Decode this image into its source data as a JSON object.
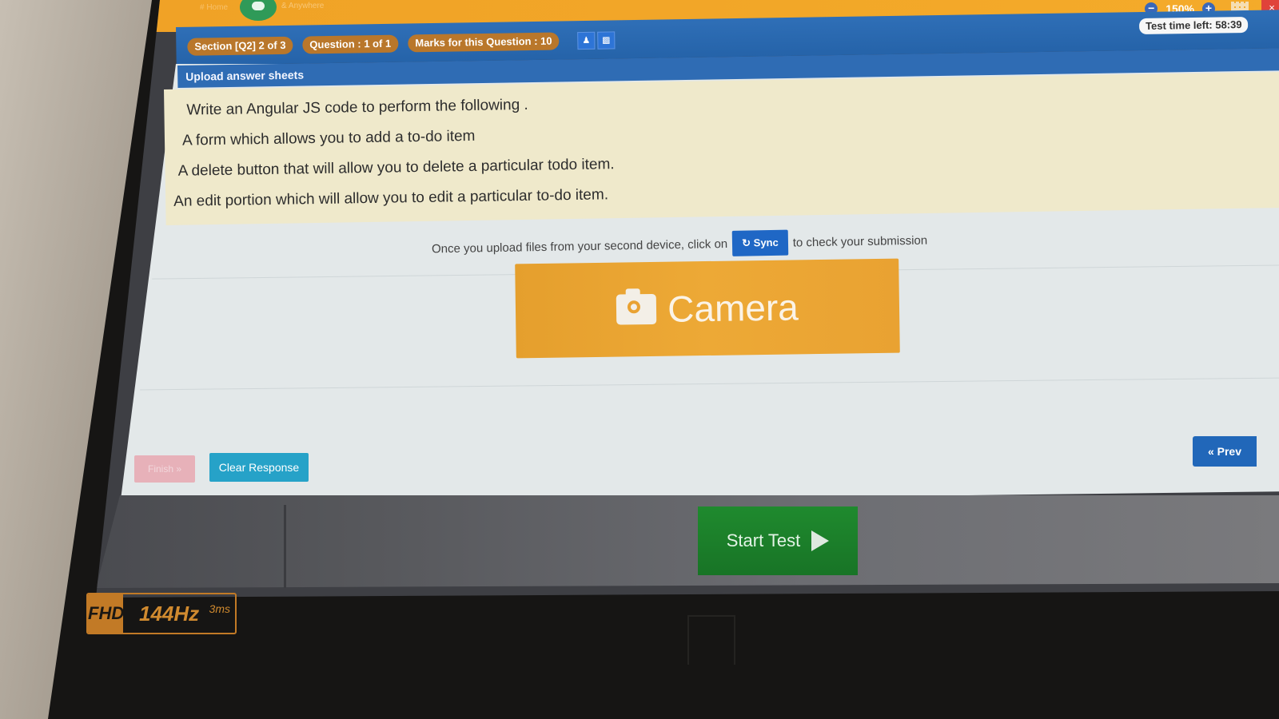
{
  "topbar": {
    "nav_label": "# Home",
    "app_label": "& Anywhere",
    "zoom_level": "150%",
    "zoom_out": "−",
    "zoom_in": "+",
    "close": "×"
  },
  "infobar": {
    "section": "Section [Q2] 2 of 3",
    "question": "Question : 1 of 1",
    "marks": "Marks for this Question : 10",
    "test_time": "Test time left: 58:39"
  },
  "question": {
    "header": "Upload answer sheets",
    "lines": [
      "Write an Angular JS code to perform the following .",
      "A form which allows you to add a to-do item",
      "A delete button that will allow you to delete a particular todo item.",
      "An edit portion which will allow you to edit a particular to-do item."
    ]
  },
  "upload": {
    "sync_prefix": "Once you upload files from your second device, click on",
    "sync_label": "Sync",
    "sync_suffix": "to check your submission",
    "camera_label": "Camera"
  },
  "actions": {
    "finish_label": "Finish »",
    "clear_label": "Clear Response",
    "prev_label": "« Prev",
    "start_label": "Start Test"
  },
  "monitor": {
    "fhd": "FHD",
    "refresh": "144Hz",
    "response": "3ms"
  },
  "colors": {
    "orange_bar": "#f4ab2a",
    "blue_bar": "#2563a9",
    "camera": "#eda936",
    "start": "#1f8a2e",
    "clear": "#26a2c8"
  }
}
